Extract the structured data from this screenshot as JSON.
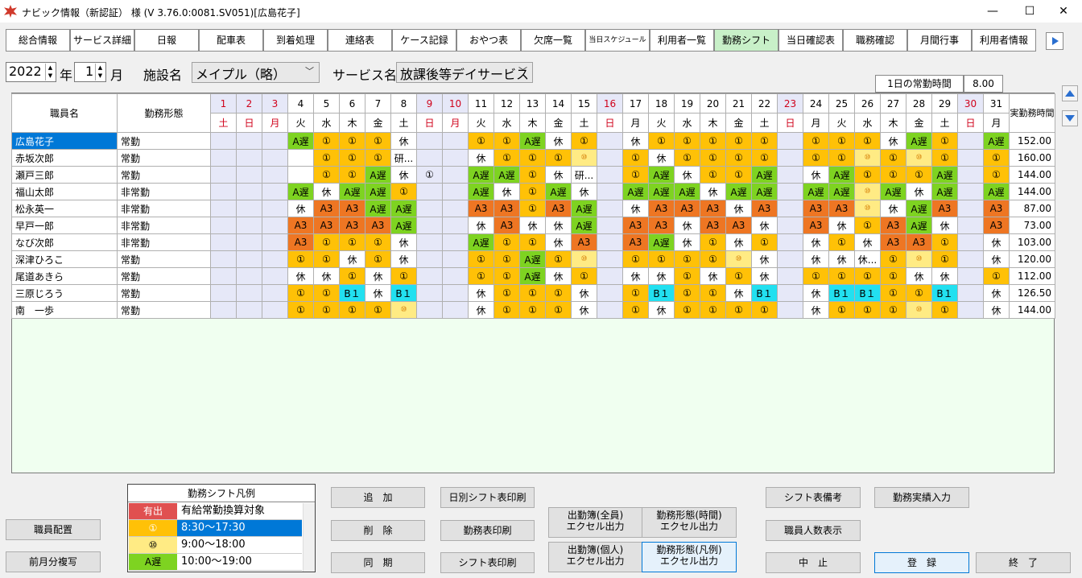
{
  "window": {
    "title": "ナビック情報（新認証） 様 (V 3.76.0:0081.SV051)[広島花子]",
    "minimize": "—",
    "maximize": "☐",
    "close": "✕"
  },
  "tabs": [
    "総合情報",
    "サービス詳細",
    "日報",
    "配車表",
    "到着処理",
    "連絡表",
    "ケース記録",
    "おやつ表",
    "欠席一覧",
    "当日スケジュール",
    "利用者一覧",
    "勤務シフト",
    "当日確認表",
    "職務確認",
    "月間行事",
    "利用者情報"
  ],
  "active_tab": "勤務シフト",
  "filters": {
    "year": "2022",
    "year_label": "年",
    "month": "1",
    "month_label": "月",
    "facility_label": "施設名",
    "facility": "メイプル（略）",
    "service_label": "サービス名",
    "service": "放課後等デイサービス"
  },
  "standard_hours": {
    "label": "1日の常勤時間",
    "value": "8.00"
  },
  "grid": {
    "col_name": "職員名",
    "col_type": "勤務形態",
    "col_total": "実勤務時間",
    "days": [
      "1",
      "2",
      "3",
      "4",
      "5",
      "6",
      "7",
      "8",
      "9",
      "10",
      "11",
      "12",
      "13",
      "14",
      "15",
      "16",
      "17",
      "18",
      "19",
      "20",
      "21",
      "22",
      "23",
      "24",
      "25",
      "26",
      "27",
      "28",
      "29",
      "30",
      "31"
    ],
    "weekdays": [
      "土",
      "日",
      "月",
      "火",
      "水",
      "木",
      "金",
      "土",
      "日",
      "月",
      "火",
      "水",
      "木",
      "金",
      "土",
      "日",
      "月",
      "火",
      "水",
      "木",
      "金",
      "土",
      "日",
      "月",
      "火",
      "水",
      "木",
      "金",
      "土",
      "日",
      "月"
    ],
    "off_days": [
      "1",
      "2",
      "3",
      "9",
      "10",
      "16",
      "23",
      "30"
    ],
    "red_days": [
      "1",
      "2",
      "3",
      "9",
      "10",
      "16",
      "23",
      "30"
    ],
    "rows": [
      {
        "name": "広島花子",
        "type": "常勤",
        "total": "152.00",
        "selected": true,
        "shifts": [
          "",
          "",
          "",
          "A遅",
          "①",
          "①",
          "①",
          "休",
          "",
          "",
          "①",
          "①",
          "A遅",
          "休",
          "①",
          "",
          "休",
          "①",
          "①",
          "①",
          "①",
          "①",
          "",
          "①",
          "①",
          "①",
          "休",
          "A遅",
          "①",
          "",
          "A遅"
        ]
      },
      {
        "name": "赤坂次郎",
        "type": "常勤",
        "total": "160.00",
        "shifts": [
          "",
          "",
          "",
          "",
          "①",
          "①",
          "①",
          "研...",
          "",
          "",
          "休",
          "①",
          "①",
          "①",
          "⑩",
          "",
          "①",
          "休",
          "①",
          "①",
          "①",
          "①",
          "",
          "①",
          "①",
          "⑩",
          "①",
          "⑩",
          "①",
          "",
          "①"
        ]
      },
      {
        "name": "瀬戸三郎",
        "type": "常勤",
        "total": "144.00",
        "shifts": [
          "",
          "",
          "",
          "",
          "①",
          "①",
          "A遅",
          "休",
          "①",
          "",
          "A遅",
          "A遅",
          "①",
          "休",
          "研...",
          "",
          "①",
          "A遅",
          "休",
          "①",
          "①",
          "A遅",
          "",
          "休",
          "A遅",
          "①",
          "①",
          "①",
          "A遅",
          "",
          "①"
        ]
      },
      {
        "name": "福山太郎",
        "type": "非常勤",
        "total": "144.00",
        "shifts": [
          "",
          "",
          "",
          "A遅",
          "休",
          "A遅",
          "A遅",
          "①",
          "",
          "",
          "A遅",
          "休",
          "①",
          "A遅",
          "休",
          "",
          "A遅",
          "A遅",
          "A遅",
          "休",
          "A遅",
          "A遅",
          "",
          "A遅",
          "A遅",
          "⑩",
          "A遅",
          "休",
          "A遅",
          "",
          "A遅"
        ]
      },
      {
        "name": "松永英一",
        "type": "非常勤",
        "total": "87.00",
        "shifts": [
          "",
          "",
          "",
          "休",
          "A3",
          "A3",
          "A遅",
          "A遅",
          "",
          "",
          "A3",
          "A3",
          "①",
          "A3",
          "A遅",
          "",
          "休",
          "A3",
          "A3",
          "A3",
          "休",
          "A3",
          "",
          "A3",
          "A3",
          "⑩",
          "休",
          "A遅",
          "A3",
          "",
          "A3"
        ]
      },
      {
        "name": "早戸一郎",
        "type": "非常勤",
        "total": "73.00",
        "shifts": [
          "",
          "",
          "",
          "A3",
          "A3",
          "A3",
          "A3",
          "A遅",
          "",
          "",
          "休",
          "A3",
          "休",
          "休",
          "A遅",
          "",
          "A3",
          "A3",
          "休",
          "A3",
          "A3",
          "休",
          "",
          "A3",
          "休",
          "①",
          "A3",
          "A遅",
          "休",
          "",
          "A3"
        ]
      },
      {
        "name": "なび次郎",
        "type": "非常勤",
        "total": "103.00",
        "shifts": [
          "",
          "",
          "",
          "A3",
          "①",
          "①",
          "①",
          "休",
          "",
          "",
          "A遅",
          "①",
          "①",
          "休",
          "A3",
          "",
          "A3",
          "A遅",
          "休",
          "①",
          "休",
          "①",
          "",
          "休",
          "①",
          "休",
          "A3",
          "A3",
          "①",
          "",
          "休"
        ]
      },
      {
        "name": "深津ひろこ",
        "type": "常勤",
        "total": "120.00",
        "shifts": [
          "",
          "",
          "",
          "①",
          "①",
          "休",
          "①",
          "休",
          "",
          "",
          "①",
          "①",
          "A遅",
          "①",
          "⑩",
          "",
          "①",
          "①",
          "①",
          "①",
          "⑩",
          "休",
          "",
          "休",
          "休",
          "休...",
          "①",
          "⑩",
          "①",
          "",
          "休"
        ]
      },
      {
        "name": "尾道あきら",
        "type": "常勤",
        "total": "112.00",
        "shifts": [
          "",
          "",
          "",
          "休",
          "休",
          "①",
          "休",
          "①",
          "",
          "",
          "①",
          "①",
          "A遅",
          "休",
          "①",
          "",
          "休",
          "休",
          "①",
          "休",
          "①",
          "休",
          "",
          "①",
          "①",
          "①",
          "①",
          "休",
          "休",
          "",
          "①"
        ]
      },
      {
        "name": "三原じろう",
        "type": "常勤",
        "total": "126.50",
        "shifts": [
          "",
          "",
          "",
          "①",
          "①",
          "B１",
          "休",
          "B１",
          "",
          "",
          "休",
          "①",
          "①",
          "①",
          "休",
          "",
          "①",
          "B１",
          "①",
          "①",
          "休",
          "B１",
          "",
          "休",
          "B１",
          "B１",
          "①",
          "①",
          "B１",
          "",
          "休"
        ]
      },
      {
        "name": "南　一歩",
        "type": "常勤",
        "total": "144.00",
        "shifts": [
          "",
          "",
          "",
          "①",
          "①",
          "①",
          "①",
          "⑩",
          "",
          "",
          "休",
          "①",
          "①",
          "①",
          "休",
          "",
          "①",
          "休",
          "①",
          "①",
          "①",
          "①",
          "",
          "休",
          "①",
          "①",
          "①",
          "⑩",
          "①",
          "",
          "休"
        ]
      }
    ]
  },
  "legend": {
    "title": "勤務シフト凡例",
    "items": [
      {
        "code": "有出",
        "text": "有給常勤換算対象",
        "color": "#e05050"
      },
      {
        "code": "①",
        "text": "8:30～17:30",
        "color": "#ffc107"
      },
      {
        "code": "⑩",
        "text": "9:00～18:00",
        "color": "#ffeb84"
      },
      {
        "code": "A遅",
        "text": "10:00～19:00",
        "color": "#7ed321"
      }
    ]
  },
  "buttons": {
    "staff_placement": "職員配置",
    "copy_prev_month": "前月分複写",
    "add": "追　加",
    "delete": "削　除",
    "sync": "同　期",
    "daily_print": "日別シフト表印刷",
    "duty_print": "勤務表印刷",
    "shift_print": "シフト表印刷",
    "attend_all_1": "出勤簿(全員)",
    "attend_all_2": "エクセル出力",
    "attend_ind_1": "出勤簿(個人)",
    "attend_ind_2": "エクセル出力",
    "form_time_1": "勤務形態(時間)",
    "form_time_2": "エクセル出力",
    "form_legend_1": "勤務形態(凡例)",
    "form_legend_2": "エクセル出力",
    "shift_note": "シフト表備考",
    "staff_count": "職員人数表示",
    "duty_actual": "勤務実績入力",
    "cancel": "中　止",
    "register": "登　録",
    "exit": "終　了"
  }
}
